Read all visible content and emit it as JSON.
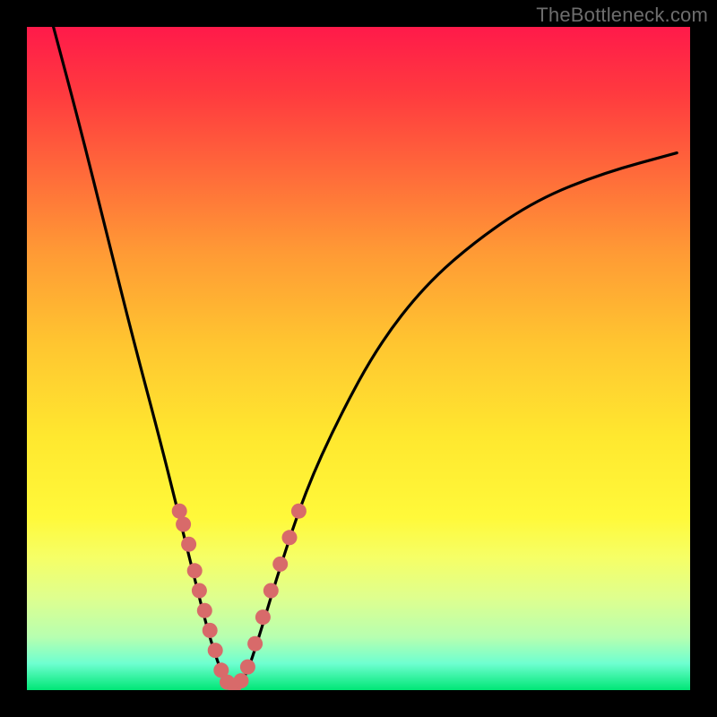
{
  "watermark": "TheBottleneck.com",
  "plot": {
    "gradient_top_fraction": 0.0,
    "gradient_bottom_fraction": 1.0
  },
  "chart_data": {
    "type": "line",
    "title": "",
    "xlabel": "",
    "ylabel": "",
    "xlim": [
      0,
      100
    ],
    "ylim": [
      0,
      100
    ],
    "grid": false,
    "legend": false,
    "series": [
      {
        "name": "bottleneck-curve",
        "x": [
          4,
          8,
          12,
          16,
          20,
          23,
          25,
          27,
          28.5,
          30,
          31.5,
          33,
          35,
          38,
          42,
          47,
          53,
          60,
          68,
          77,
          87,
          98
        ],
        "y": [
          100,
          85,
          69,
          53,
          38,
          26,
          18,
          10,
          5,
          1,
          0.5,
          2,
          8,
          18,
          30,
          41,
          52,
          61,
          68,
          74,
          78,
          81
        ]
      }
    ],
    "points": [
      {
        "name": "left-cluster",
        "coords": [
          {
            "x": 23.0,
            "y": 27
          },
          {
            "x": 23.6,
            "y": 25
          },
          {
            "x": 24.4,
            "y": 22
          },
          {
            "x": 25.3,
            "y": 18
          },
          {
            "x": 26.0,
            "y": 15
          },
          {
            "x": 26.8,
            "y": 12
          },
          {
            "x": 27.6,
            "y": 9
          },
          {
            "x": 28.4,
            "y": 6
          },
          {
            "x": 29.3,
            "y": 3
          },
          {
            "x": 30.2,
            "y": 1.2
          },
          {
            "x": 31.3,
            "y": 0.7
          },
          {
            "x": 32.3,
            "y": 1.4
          }
        ]
      },
      {
        "name": "right-cluster",
        "coords": [
          {
            "x": 33.3,
            "y": 3.5
          },
          {
            "x": 34.4,
            "y": 7
          },
          {
            "x": 35.6,
            "y": 11
          },
          {
            "x": 36.8,
            "y": 15
          },
          {
            "x": 38.2,
            "y": 19
          },
          {
            "x": 39.6,
            "y": 23
          },
          {
            "x": 41.0,
            "y": 27
          }
        ]
      }
    ],
    "background_gradient": [
      {
        "stop": 0.0,
        "color": "#ff1a4a"
      },
      {
        "stop": 0.1,
        "color": "#ff3a3f"
      },
      {
        "stop": 0.22,
        "color": "#ff6a3a"
      },
      {
        "stop": 0.34,
        "color": "#ff9a35"
      },
      {
        "stop": 0.48,
        "color": "#ffc630"
      },
      {
        "stop": 0.62,
        "color": "#ffe82f"
      },
      {
        "stop": 0.74,
        "color": "#fff93a"
      },
      {
        "stop": 0.8,
        "color": "#f6ff66"
      },
      {
        "stop": 0.86,
        "color": "#dfff8e"
      },
      {
        "stop": 0.92,
        "color": "#b7ffb0"
      },
      {
        "stop": 0.96,
        "color": "#6effd0"
      },
      {
        "stop": 1.0,
        "color": "#00e676"
      }
    ]
  }
}
